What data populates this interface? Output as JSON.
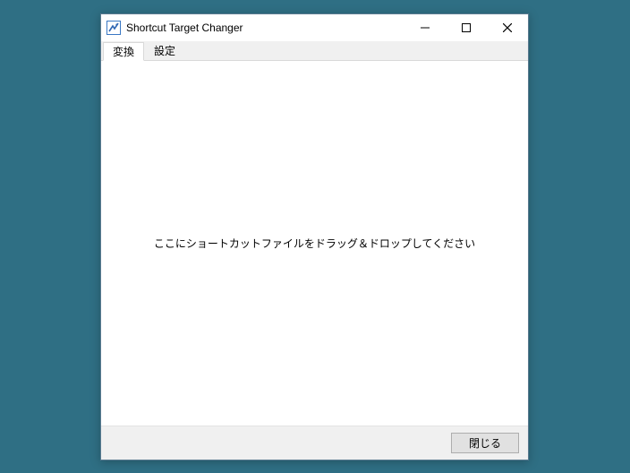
{
  "window": {
    "title": "Shortcut Target Changer"
  },
  "tabs": [
    {
      "label": "変換",
      "active": true
    },
    {
      "label": "設定",
      "active": false
    }
  ],
  "dropzone": {
    "label": "ここにショートカットファイルをドラッグ＆ドロップしてください"
  },
  "footer": {
    "close_label": "閉じる"
  }
}
